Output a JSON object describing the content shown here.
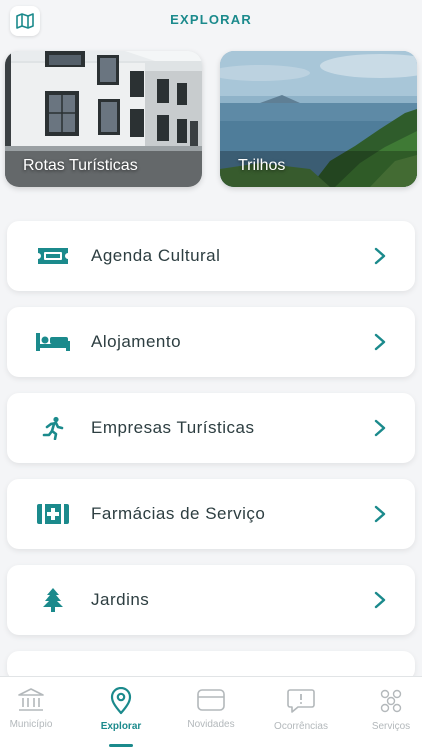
{
  "header": {
    "title": "EXPLORAR",
    "map_icon": "map-icon"
  },
  "cards": [
    {
      "label": "Rotas Turísticas",
      "icon": "photo-buildings"
    },
    {
      "label": "Trilhos",
      "icon": "photo-coast"
    }
  ],
  "menu": [
    {
      "label": "Agenda Cultural",
      "icon": "ticket-icon"
    },
    {
      "label": "Alojamento",
      "icon": "bed-icon"
    },
    {
      "label": "Empresas Turísticas",
      "icon": "running-person-icon"
    },
    {
      "label": "Farmácias de Serviço",
      "icon": "first-aid-kit-icon"
    },
    {
      "label": "Jardins",
      "icon": "tree-icon"
    }
  ],
  "bottom_nav": [
    {
      "label": "Município",
      "icon": "building-columns-icon",
      "active": false
    },
    {
      "label": "Explorar",
      "icon": "location-pin-icon",
      "active": true
    },
    {
      "label": "Novidades",
      "icon": "news-card-icon",
      "active": false
    },
    {
      "label": "Ocorrências",
      "icon": "speech-bubble-alert-icon",
      "active": false
    },
    {
      "label": "Serviços",
      "icon": "services-cluster-icon",
      "active": false
    }
  ],
  "colors": {
    "accent": "#1b8a8c",
    "background": "#f4f5f7",
    "card": "#ffffff",
    "inactive": "#b3b8bb"
  }
}
